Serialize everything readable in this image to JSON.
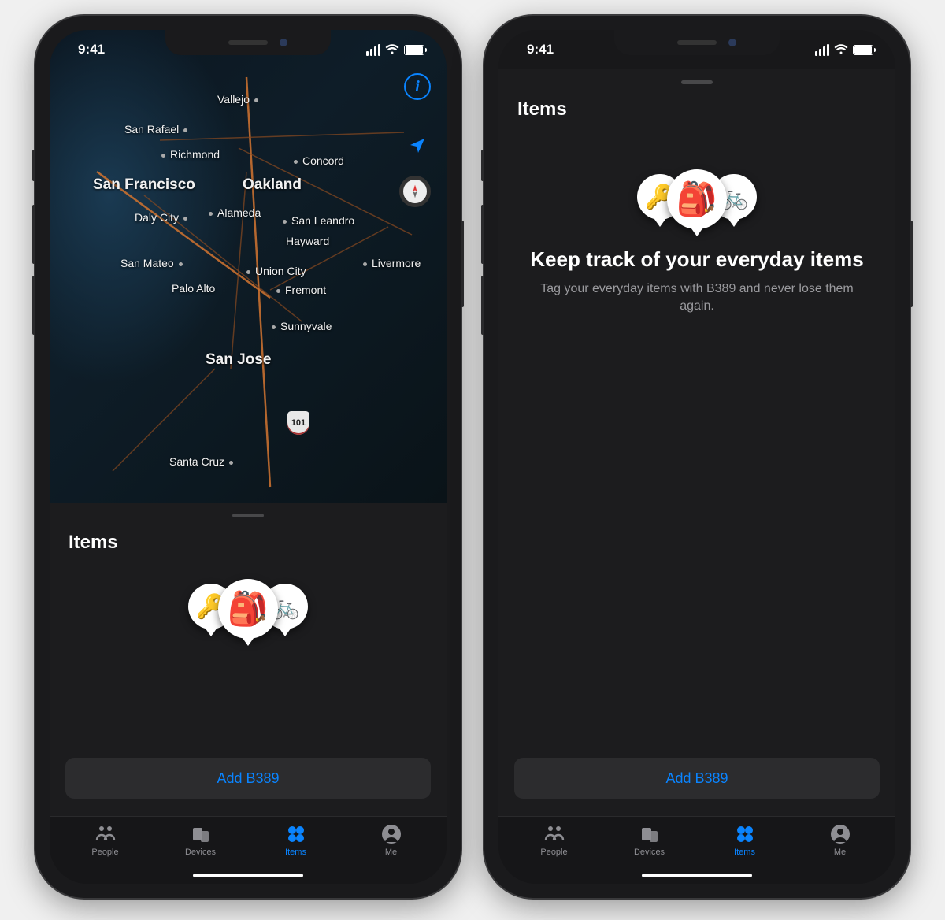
{
  "status": {
    "time": "9:41"
  },
  "map": {
    "cities": {
      "san_francisco": "San Francisco",
      "oakland": "Oakland",
      "san_jose": "San Jose",
      "vallejo": "Vallejo",
      "san_rafael": "San Rafael",
      "richmond": "Richmond",
      "concord": "Concord",
      "daly_city": "Daly City",
      "alameda": "Alameda",
      "san_leandro": "San Leandro",
      "hayward": "Hayward",
      "livermore": "Livermore",
      "san_mateo": "San Mateo",
      "union_city": "Union City",
      "fremont": "Fremont",
      "palo_alto": "Palo Alto",
      "sunnyvale": "Sunnyvale",
      "santa_cruz": "Santa Cruz"
    },
    "route101": "101"
  },
  "drawer": {
    "title": "Items",
    "add_button": "Add B389",
    "hero_title": "Keep track of your everyday items",
    "hero_sub": "Tag your everyday items with B389 and never lose them again.",
    "icons": {
      "key": "🔑",
      "backpack": "🎒",
      "bike": "🚲"
    }
  },
  "tabs": {
    "people": "People",
    "devices": "Devices",
    "items": "Items",
    "me": "Me"
  },
  "colors": {
    "accent": "#0a84ff"
  }
}
